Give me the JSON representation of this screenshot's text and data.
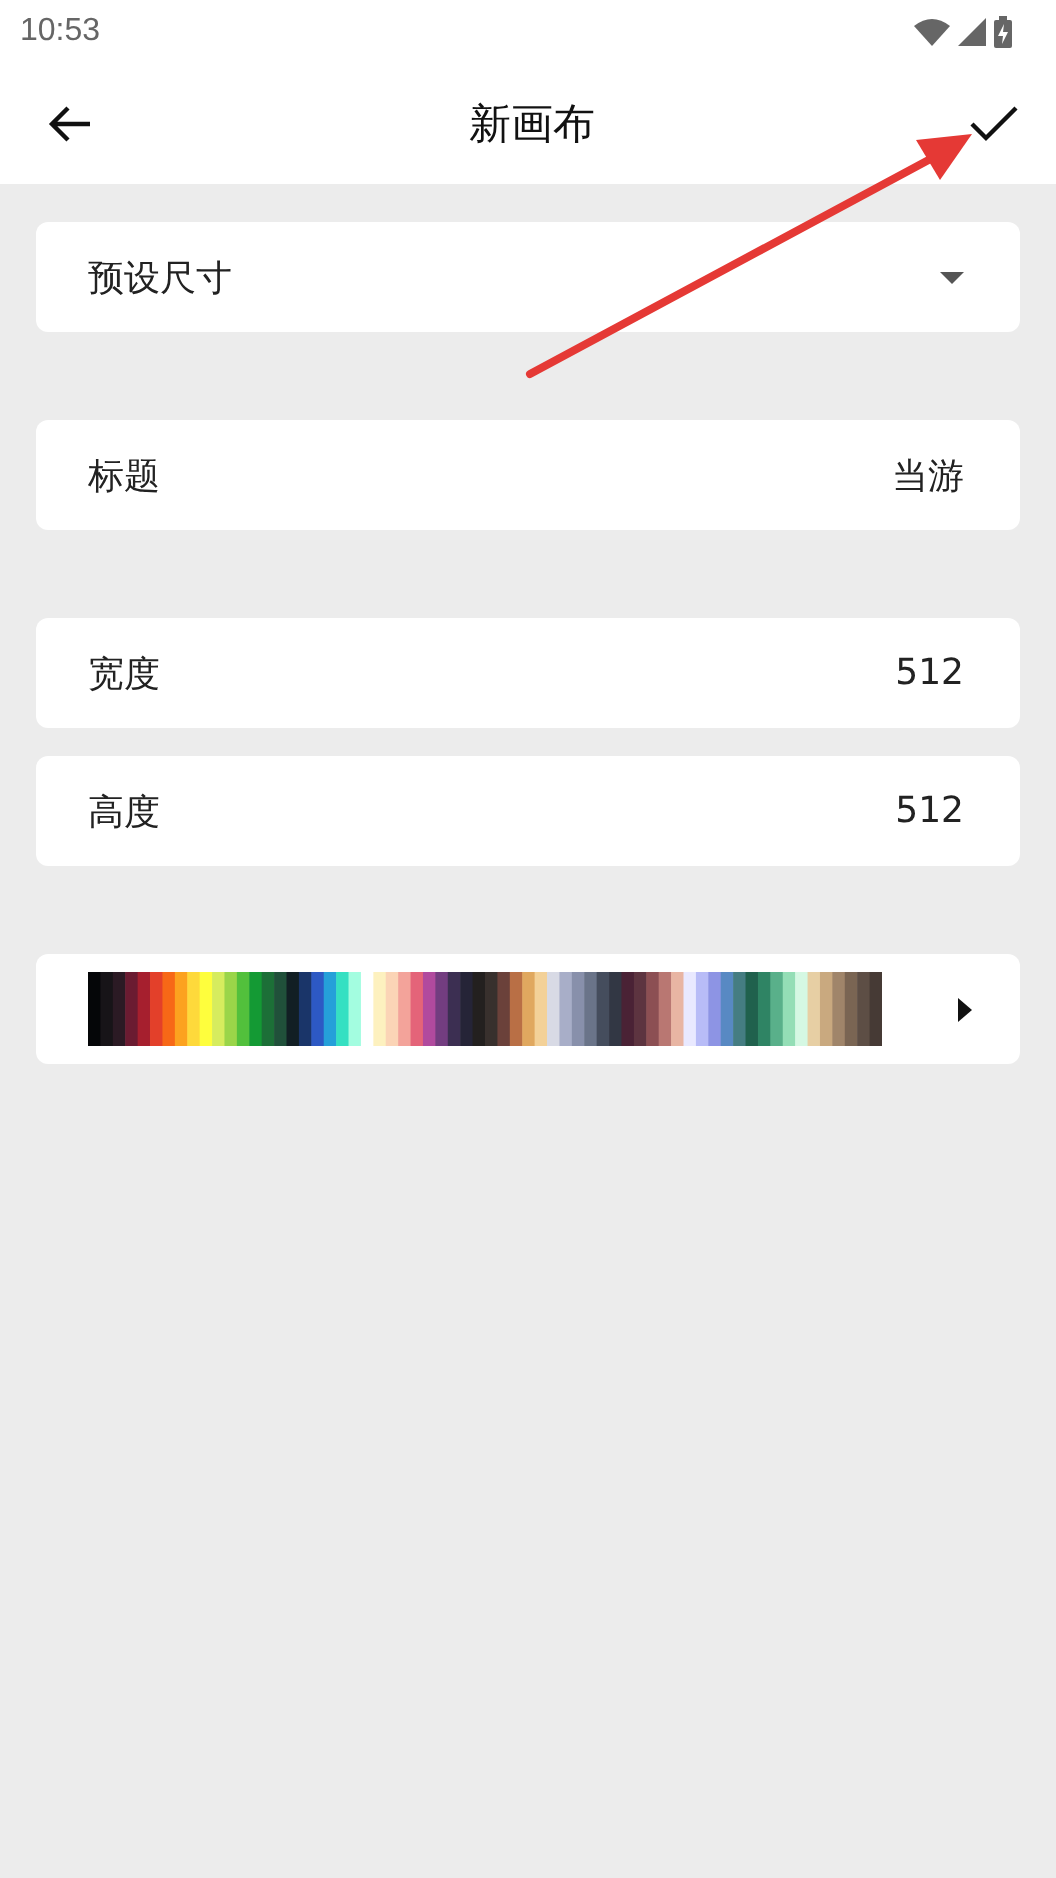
{
  "status_bar": {
    "time": "10:53"
  },
  "app_bar": {
    "title": "新画布"
  },
  "groups": [
    {
      "rows": [
        {
          "kind": "dropdown",
          "label": "预设尺寸"
        }
      ]
    },
    {
      "rows": [
        {
          "kind": "value",
          "label": "标题",
          "value": "当游"
        }
      ]
    },
    {
      "rows": [
        {
          "kind": "value",
          "label": "宽度",
          "value": "512"
        },
        {
          "kind": "value",
          "label": "高度",
          "value": "512"
        }
      ]
    },
    {
      "rows": [
        {
          "kind": "palette"
        }
      ]
    }
  ]
}
